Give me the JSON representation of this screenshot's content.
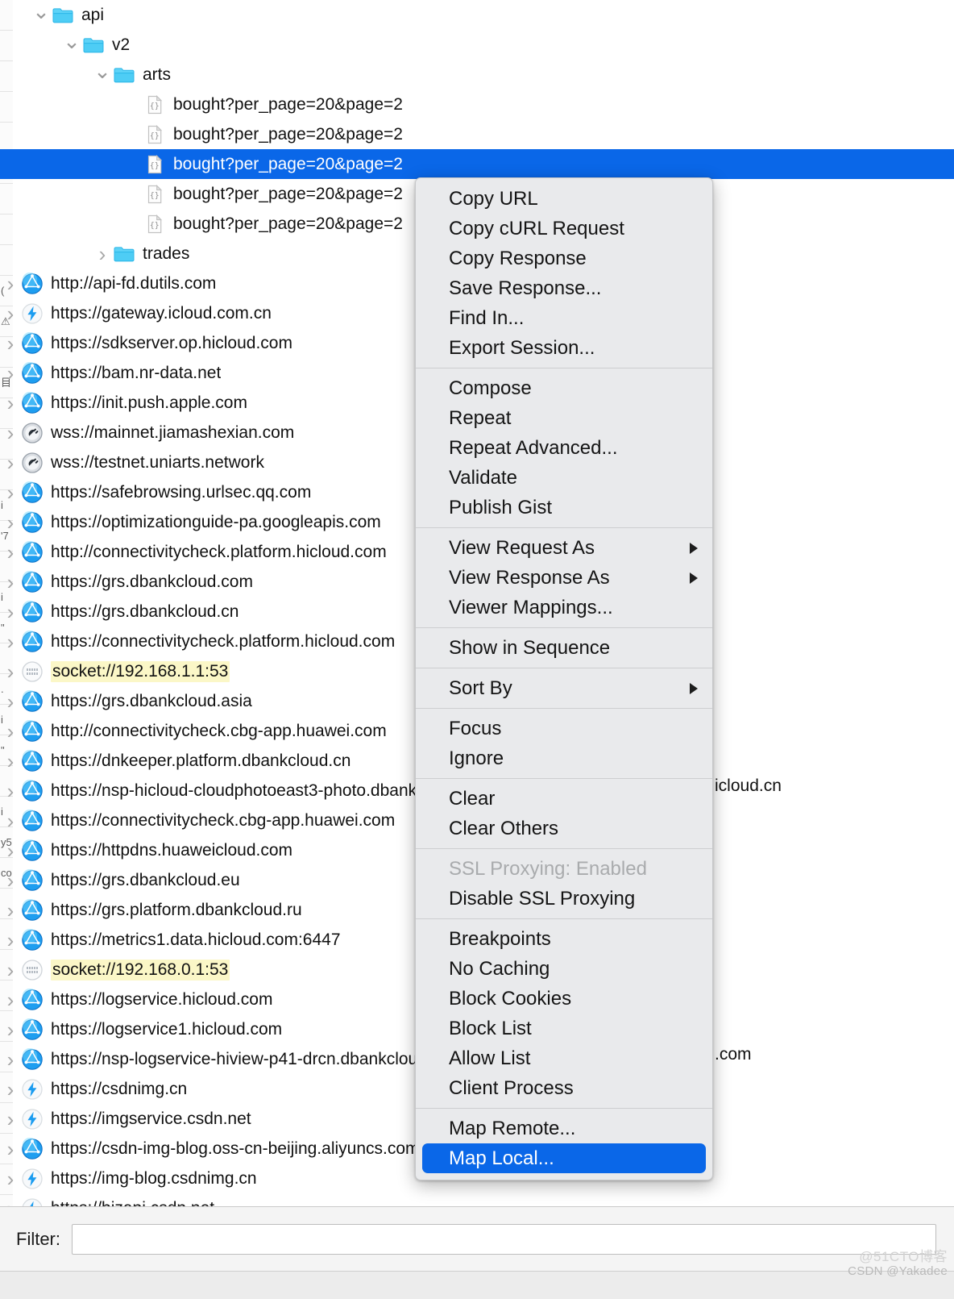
{
  "left_sliver": {
    "rows": [
      "",
      "",
      "",
      "",
      "",
      "",
      "",
      "",
      "",
      "(",
      "⚠",
      "",
      "目",
      "",
      "",
      "",
      "i",
      "'7",
      "",
      "i",
      "\"",
      "",
      ".",
      "i",
      "\"",
      "",
      "i",
      "y5",
      "co",
      "",
      "",
      "",
      "",
      "",
      "",
      "",
      "",
      "",
      "",
      ""
    ]
  },
  "tree": {
    "nodes": [
      {
        "indent": 1,
        "disclosure": "down",
        "icon": "folder-icon",
        "label": "api",
        "selected": false,
        "highlight": false
      },
      {
        "indent": 2,
        "disclosure": "down",
        "icon": "folder-icon",
        "label": "v2",
        "selected": false,
        "highlight": false
      },
      {
        "indent": 3,
        "disclosure": "down",
        "icon": "folder-icon",
        "label": "arts",
        "selected": false,
        "highlight": false
      },
      {
        "indent": 4,
        "disclosure": "none",
        "icon": "json-file-icon",
        "label": "bought?per_page=20&page=2",
        "selected": false,
        "highlight": false
      },
      {
        "indent": 4,
        "disclosure": "none",
        "icon": "json-file-icon",
        "label": "bought?per_page=20&page=2",
        "selected": false,
        "highlight": false
      },
      {
        "indent": 4,
        "disclosure": "none",
        "icon": "json-file-icon",
        "label": "bought?per_page=20&page=2",
        "selected": true,
        "highlight": false
      },
      {
        "indent": 4,
        "disclosure": "none",
        "icon": "json-file-icon",
        "label": "bought?per_page=20&page=2",
        "selected": false,
        "highlight": false
      },
      {
        "indent": 4,
        "disclosure": "none",
        "icon": "json-file-icon",
        "label": "bought?per_page=20&page=2",
        "selected": false,
        "highlight": false
      },
      {
        "indent": 3,
        "disclosure": "right",
        "icon": "folder-icon",
        "label": "trades",
        "selected": false,
        "highlight": false
      },
      {
        "indent": 0,
        "disclosure": "right",
        "icon": "globe-icon",
        "label": "http://api-fd.dutils.com",
        "selected": false,
        "highlight": false
      },
      {
        "indent": 0,
        "disclosure": "right",
        "icon": "bolt-icon",
        "label": "https://gateway.icloud.com.cn",
        "selected": false,
        "highlight": false
      },
      {
        "indent": 0,
        "disclosure": "right",
        "icon": "globe-icon",
        "label": "https://sdkserver.op.hicloud.com",
        "selected": false,
        "highlight": false
      },
      {
        "indent": 0,
        "disclosure": "right",
        "icon": "globe-icon",
        "label": "https://bam.nr-data.net",
        "selected": false,
        "highlight": false
      },
      {
        "indent": 0,
        "disclosure": "right",
        "icon": "globe-icon",
        "label": "https://init.push.apple.com",
        "selected": false,
        "highlight": false
      },
      {
        "indent": 0,
        "disclosure": "right",
        "icon": "plug-icon",
        "label": "wss://mainnet.jiamashexian.com",
        "selected": false,
        "highlight": false
      },
      {
        "indent": 0,
        "disclosure": "right",
        "icon": "plug-icon",
        "label": "wss://testnet.uniarts.network",
        "selected": false,
        "highlight": false
      },
      {
        "indent": 0,
        "disclosure": "right",
        "icon": "globe-icon",
        "label": "https://safebrowsing.urlsec.qq.com",
        "selected": false,
        "highlight": false
      },
      {
        "indent": 0,
        "disclosure": "right",
        "icon": "globe-icon",
        "label": "https://optimizationguide-pa.googleapis.com",
        "selected": false,
        "highlight": false
      },
      {
        "indent": 0,
        "disclosure": "right",
        "icon": "globe-icon",
        "label": "http://connectivitycheck.platform.hicloud.com",
        "selected": false,
        "highlight": false
      },
      {
        "indent": 0,
        "disclosure": "right",
        "icon": "globe-icon",
        "label": "https://grs.dbankcloud.com",
        "selected": false,
        "highlight": false
      },
      {
        "indent": 0,
        "disclosure": "right",
        "icon": "globe-icon",
        "label": "https://grs.dbankcloud.cn",
        "selected": false,
        "highlight": false
      },
      {
        "indent": 0,
        "disclosure": "right",
        "icon": "globe-icon",
        "label": "https://connectivitycheck.platform.hicloud.com",
        "selected": false,
        "highlight": false
      },
      {
        "indent": 0,
        "disclosure": "right",
        "icon": "socket-icon",
        "label": "socket://192.168.1.1:53",
        "selected": false,
        "highlight": true
      },
      {
        "indent": 0,
        "disclosure": "right",
        "icon": "globe-icon",
        "label": "https://grs.dbankcloud.asia",
        "selected": false,
        "highlight": false
      },
      {
        "indent": 0,
        "disclosure": "right",
        "icon": "globe-icon",
        "label": "http://connectivitycheck.cbg-app.huawei.com",
        "selected": false,
        "highlight": false
      },
      {
        "indent": 0,
        "disclosure": "right",
        "icon": "globe-icon",
        "label": "https://dnkeeper.platform.dbankcloud.cn",
        "selected": false,
        "highlight": false
      },
      {
        "indent": 0,
        "disclosure": "right",
        "icon": "globe-icon",
        "label": "https://nsp-hicloud-cloudphotoeast3-photo.dbankcloud.cn",
        "selected": false,
        "highlight": false
      },
      {
        "indent": 0,
        "disclosure": "right",
        "icon": "globe-icon",
        "label": "https://connectivitycheck.cbg-app.huawei.com",
        "selected": false,
        "highlight": false
      },
      {
        "indent": 0,
        "disclosure": "right",
        "icon": "globe-icon",
        "label": "https://httpdns.huaweicloud.com",
        "selected": false,
        "highlight": false
      },
      {
        "indent": 0,
        "disclosure": "right",
        "icon": "globe-icon",
        "label": "https://grs.dbankcloud.eu",
        "selected": false,
        "highlight": false
      },
      {
        "indent": 0,
        "disclosure": "right",
        "icon": "globe-icon",
        "label": "https://grs.platform.dbankcloud.ru",
        "selected": false,
        "highlight": false
      },
      {
        "indent": 0,
        "disclosure": "right",
        "icon": "globe-icon",
        "label": "https://metrics1.data.hicloud.com:6447",
        "selected": false,
        "highlight": false
      },
      {
        "indent": 0,
        "disclosure": "right",
        "icon": "socket-icon",
        "label": "socket://192.168.0.1:53",
        "selected": false,
        "highlight": true
      },
      {
        "indent": 0,
        "disclosure": "right",
        "icon": "globe-icon",
        "label": "https://logservice.hicloud.com",
        "selected": false,
        "highlight": false
      },
      {
        "indent": 0,
        "disclosure": "right",
        "icon": "globe-icon",
        "label": "https://logservice1.hicloud.com",
        "selected": false,
        "highlight": false
      },
      {
        "indent": 0,
        "disclosure": "right",
        "icon": "globe-icon",
        "label": "https://nsp-logservice-hiview-p41-drcn.dbankcloud.com",
        "selected": false,
        "highlight": false
      },
      {
        "indent": 0,
        "disclosure": "right",
        "icon": "bolt-icon",
        "label": "https://csdnimg.cn",
        "selected": false,
        "highlight": false
      },
      {
        "indent": 0,
        "disclosure": "right",
        "icon": "bolt-icon",
        "label": "https://imgservice.csdn.net",
        "selected": false,
        "highlight": false
      },
      {
        "indent": 0,
        "disclosure": "right",
        "icon": "globe-icon",
        "label": "https://csdn-img-blog.oss-cn-beijing.aliyuncs.com",
        "selected": false,
        "highlight": false
      },
      {
        "indent": 0,
        "disclosure": "right",
        "icon": "bolt-icon",
        "label": "https://img-blog.csdnimg.cn",
        "selected": false,
        "highlight": false
      },
      {
        "indent": 0,
        "disclosure": "right",
        "icon": "bolt-icon",
        "label": "https://bizapi.csdn.net",
        "selected": false,
        "highlight": false
      }
    ]
  },
  "filter": {
    "label": "Filter:",
    "value": "",
    "placeholder": ""
  },
  "context_menu": {
    "groups": [
      {
        "items": [
          {
            "label": "Copy URL",
            "submenu": false,
            "disabled": false,
            "highlight": false
          },
          {
            "label": "Copy cURL Request",
            "submenu": false,
            "disabled": false,
            "highlight": false
          },
          {
            "label": "Copy Response",
            "submenu": false,
            "disabled": false,
            "highlight": false
          },
          {
            "label": "Save Response...",
            "submenu": false,
            "disabled": false,
            "highlight": false
          },
          {
            "label": "Find In...",
            "submenu": false,
            "disabled": false,
            "highlight": false
          },
          {
            "label": "Export Session...",
            "submenu": false,
            "disabled": false,
            "highlight": false
          }
        ]
      },
      {
        "items": [
          {
            "label": "Compose",
            "submenu": false,
            "disabled": false,
            "highlight": false
          },
          {
            "label": "Repeat",
            "submenu": false,
            "disabled": false,
            "highlight": false
          },
          {
            "label": "Repeat Advanced...",
            "submenu": false,
            "disabled": false,
            "highlight": false
          },
          {
            "label": "Validate",
            "submenu": false,
            "disabled": false,
            "highlight": false
          },
          {
            "label": "Publish Gist",
            "submenu": false,
            "disabled": false,
            "highlight": false
          }
        ]
      },
      {
        "items": [
          {
            "label": "View Request As",
            "submenu": true,
            "disabled": false,
            "highlight": false
          },
          {
            "label": "View Response As",
            "submenu": true,
            "disabled": false,
            "highlight": false
          },
          {
            "label": "Viewer Mappings...",
            "submenu": false,
            "disabled": false,
            "highlight": false
          }
        ]
      },
      {
        "items": [
          {
            "label": "Show in Sequence",
            "submenu": false,
            "disabled": false,
            "highlight": false
          }
        ]
      },
      {
        "items": [
          {
            "label": "Sort By",
            "submenu": true,
            "disabled": false,
            "highlight": false
          }
        ]
      },
      {
        "items": [
          {
            "label": "Focus",
            "submenu": false,
            "disabled": false,
            "highlight": false
          },
          {
            "label": "Ignore",
            "submenu": false,
            "disabled": false,
            "highlight": false
          }
        ]
      },
      {
        "items": [
          {
            "label": "Clear",
            "submenu": false,
            "disabled": false,
            "highlight": false
          },
          {
            "label": "Clear Others",
            "submenu": false,
            "disabled": false,
            "highlight": false
          }
        ]
      },
      {
        "items": [
          {
            "label": "SSL Proxying: Enabled",
            "submenu": false,
            "disabled": true,
            "highlight": false
          },
          {
            "label": "Disable SSL Proxying",
            "submenu": false,
            "disabled": false,
            "highlight": false
          }
        ]
      },
      {
        "items": [
          {
            "label": "Breakpoints",
            "submenu": false,
            "disabled": false,
            "highlight": false
          },
          {
            "label": "No Caching",
            "submenu": false,
            "disabled": false,
            "highlight": false
          },
          {
            "label": "Block Cookies",
            "submenu": false,
            "disabled": false,
            "highlight": false
          },
          {
            "label": "Block List",
            "submenu": false,
            "disabled": false,
            "highlight": false
          },
          {
            "label": "Allow List",
            "submenu": false,
            "disabled": false,
            "highlight": false
          },
          {
            "label": "Client Process",
            "submenu": false,
            "disabled": false,
            "highlight": false
          }
        ]
      },
      {
        "items": [
          {
            "label": "Map Remote...",
            "submenu": false,
            "disabled": false,
            "highlight": false
          },
          {
            "label": "Map Local...",
            "submenu": false,
            "disabled": false,
            "highlight": true
          }
        ]
      }
    ]
  },
  "occluded_text": {
    "icloud_cn": "icloud.cn",
    "dot_com": ".com"
  },
  "watermark": {
    "line1": "@51CTO博客",
    "line2": "CSDN @Yakadee"
  },
  "colors": {
    "selection_blue": "#0a67e8",
    "highlight_yellow": "#fbf7c7",
    "menu_bg": "#e9eaec",
    "folder_blue": "#4ecdf5"
  }
}
